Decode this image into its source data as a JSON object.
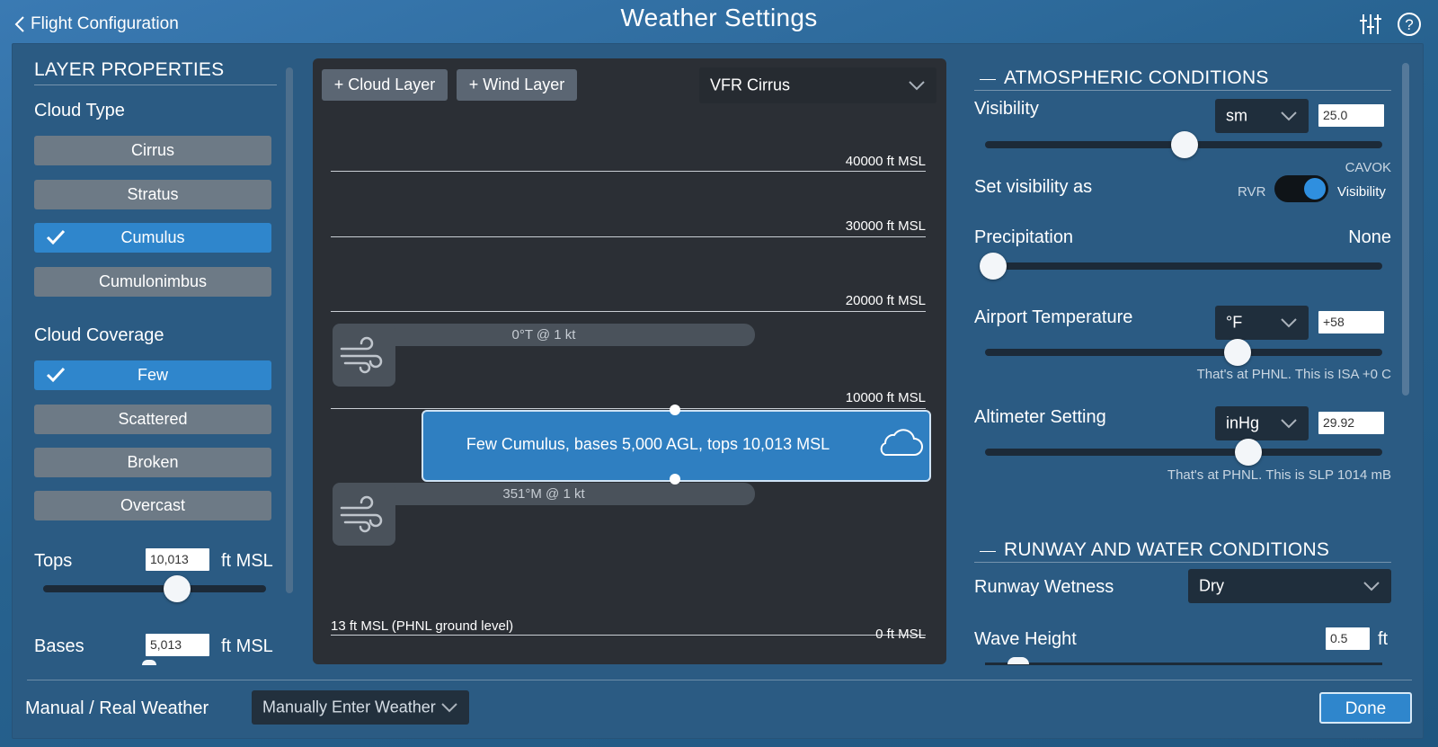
{
  "topbar": {
    "back_label": "Flight Configuration",
    "title": "Weather Settings",
    "icons": [
      "sliders-icon",
      "help-icon"
    ]
  },
  "layer_properties": {
    "title": "LAYER PROPERTIES",
    "cloud_type_label": "Cloud Type",
    "cloud_types": [
      "Cirrus",
      "Stratus",
      "Cumulus",
      "Cumulonimbus"
    ],
    "cloud_type_selected": "Cumulus",
    "coverage_label": "Cloud Coverage",
    "coverages": [
      "Few",
      "Scattered",
      "Broken",
      "Overcast"
    ],
    "coverage_selected": "Few",
    "tops_label": "Tops",
    "tops_value": "10,013",
    "tops_unit": "ft MSL",
    "bases_label": "Bases",
    "bases_value": "5,013",
    "bases_unit": "ft MSL"
  },
  "canvas": {
    "add_cloud": "+ Cloud Layer",
    "add_wind": "+ Wind Layer",
    "preset": "VFR Cirrus",
    "altitudes": [
      "40000 ft MSL",
      "30000 ft MSL",
      "20000 ft MSL",
      "10000 ft MSL",
      "0 ft MSL"
    ],
    "ground_label": "13 ft MSL (PHNL ground level)",
    "wind_upper": "0°T @ 1 kt",
    "wind_lower": "351°M @ 1 kt",
    "cloud_layer_text": "Few Cumulus, bases 5,000 AGL, tops 10,013 MSL"
  },
  "atmo": {
    "title": "ATMOSPHERIC CONDITIONS",
    "visibility_label": "Visibility",
    "visibility_unit": "sm",
    "visibility_value": "25.0",
    "cavok": "CAVOK",
    "set_vis_label": "Set visibility as",
    "rvr": "RVR",
    "vis_opt": "Visibility",
    "precip_label": "Precipitation",
    "precip_value": "None",
    "temp_label": "Airport Temperature",
    "temp_unit": "°F",
    "temp_value": "+58",
    "temp_note": "That's at PHNL. This is ISA +0 C",
    "alt_label": "Altimeter Setting",
    "alt_unit": "inHg",
    "alt_value": "29.92",
    "alt_note": "That's at PHNL. This is SLP 1014 mB"
  },
  "runway": {
    "title": "RUNWAY AND WATER CONDITIONS",
    "wetness_label": "Runway Wetness",
    "wetness_value": "Dry",
    "wave_label": "Wave Height",
    "wave_value": "0.5",
    "wave_unit": "ft"
  },
  "footer": {
    "mode_label": "Manual / Real Weather",
    "mode_value": "Manually Enter Weather",
    "done": "Done"
  },
  "slider_levels": {
    "tops": 0.6,
    "visibility": 0.5,
    "precipitation": 0.0,
    "temperature": 0.64,
    "altimeter": 0.67
  }
}
